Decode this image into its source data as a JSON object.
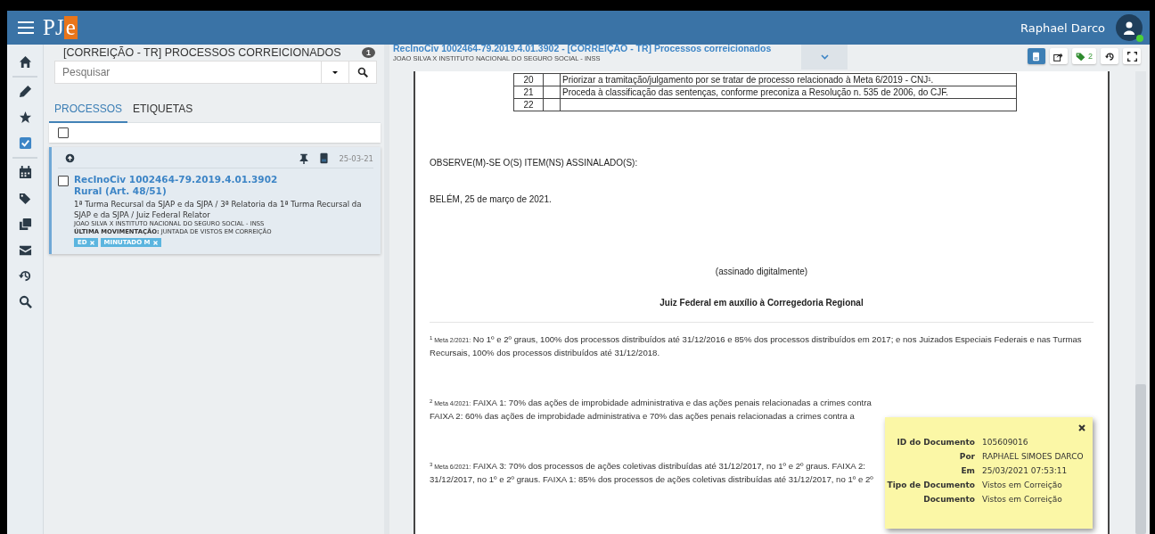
{
  "header": {
    "logo_main": "PJ",
    "logo_accent": "e",
    "user_name": "Raphael Darco",
    "user_online": true
  },
  "rail": [
    {
      "selected": false
    },
    {
      "selected": false
    },
    {
      "selected": false
    },
    {
      "selected": true
    },
    {
      "selected": false
    },
    {
      "selected": false
    },
    {
      "selected": false
    },
    {
      "selected": false
    },
    {
      "selected": false
    },
    {
      "selected": false
    }
  ],
  "task_panel": {
    "title": "[CORREIÇÃO - TR] PROCESSOS CORREICIONADOS",
    "count": "1",
    "search": {
      "placeholder": "Pesquisar"
    },
    "tabs": [
      {
        "label": "PROCESSOS",
        "selected": true
      },
      {
        "label": "ETIQUETAS",
        "selected": false
      }
    ],
    "select_all": {
      "checked": false
    },
    "processes": [
      {
        "selected": true,
        "checked": false,
        "date": "25-03-21",
        "number": "RecInoCiv 1002464-79.2019.4.01.3902",
        "subject": "Rural (Art. 48/51)",
        "court": "1ª Turma Recursal da SJAP e da SJPA / 3ª Relatoria da 1ª Turma Recursal da SJAP e da SJPA / Juiz Federal Relator",
        "parties": "JOAO SILVA X INSTITUTO NACIONAL DO SEGURO SOCIAL - INSS",
        "movement": "**ÚLTIMA MOVIMENTAÇÃO:** JUNTADA DE VISTOS EM CORREIÇÃO",
        "tags": [
          "ED",
          "MINUTADO M"
        ]
      }
    ]
  },
  "viewer": {
    "title": "RecInoCiv 1002464-79.2019.4.01.3902 - [CORREIÇÃO - TR] Processos correicionados",
    "subtitle": "JOAO SILVA X INSTITUTO NACIONAL DO SEGURO SOCIAL - INSS",
    "toolbar": [
      {
        "selected": true
      },
      {
        "selected": false
      },
      {
        "selected": false,
        "count": "2"
      },
      {
        "selected": false
      },
      {
        "selected": false
      }
    ],
    "document": {
      "table_rows": [
        {
          "number": "20",
          "text": "Priorizar a tramitação/julgamento por se tratar de processo relacionado à Meta 6/2019 - CNJ¹."
        },
        {
          "number": "21",
          "text": "Proceda à classificação das sentenças, conforme preconiza a Resolução n. 535 de 2006, do CJF."
        },
        {
          "number": "22"
        }
      ],
      "observe": "OBSERVE(M)-SE O(S) ITEM(NS) ASSINALADO(S):",
      "place_date": "BELÉM, 25 de março de 2021.",
      "signature_note": "(assinado digitalmente)",
      "signer": "Juiz Federal em auxílio à Corregedoria Regional",
      "footnotes": [
        {
          "mark": "1",
          "label": "Meta 2/2021:",
          "lines": [
            "No 1º e 2º graus, 100% dos processos distribuídos até 31/12/2016 e 85% dos processos distribuídos em 2017; e nos Juizados Especiais Federais e nas Turmas Recursais, 100% dos processos distribuídos até 31/12/2018."
          ]
        },
        {
          "mark": "2",
          "label": "Meta 4/2021:",
          "lines": [
            "FAIXA 1: 70% das ações de improbidade administrativa e das ações penais relacionadas a crimes contra",
            "FAIXA 2: 60% das ações de improbidade administrativa e 70% das ações penais relacionadas a crimes contra a"
          ]
        },
        {
          "mark": "3",
          "label": "Meta 6/2021:",
          "lines": [
            "FAIXA 3: 70% dos processos de ações coletivas distribuídas até 31/12/2017, no 1º e 2º graus. FAIXA 2:",
            "31/12/2017, no 1º e 2º graus. FAIXA 1: 85% dos processos de ações coletivas distribuídas até 31/12/2017, no 1º e 2º"
          ]
        }
      ]
    },
    "info_popup": {
      "rows": [
        {
          "label": "ID do Documento",
          "value": "105609016"
        },
        {
          "label": "Por",
          "value": "RAPHAEL SIMOES DARCO"
        },
        {
          "label": "Em",
          "value": "25/03/2021 07:53:11"
        },
        {
          "label": "Tipo de Documento",
          "value": "Vistos em Correição"
        },
        {
          "label": "Documento",
          "value": "Vistos em Correição"
        }
      ]
    }
  }
}
